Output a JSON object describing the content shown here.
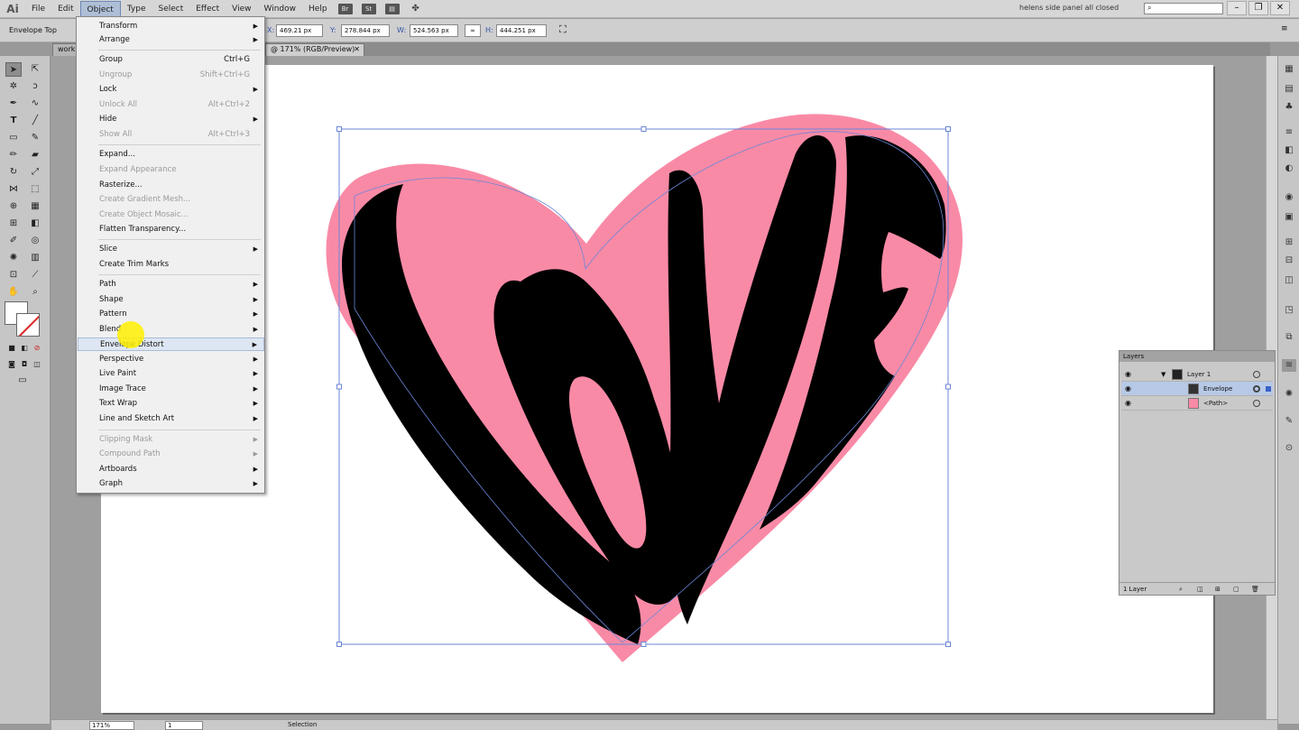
{
  "app": {
    "logo": "Ai"
  },
  "menubar": {
    "items": [
      "File",
      "Edit",
      "Object",
      "Type",
      "Select",
      "Effect",
      "View",
      "Window",
      "Help"
    ],
    "active": "Object",
    "icons": [
      "Br",
      "St"
    ],
    "workspace": "helens side panel all closed",
    "search_placeholder": ""
  },
  "control_bar": {
    "selection_label": "Envelope Top",
    "x_label": "X:",
    "x_value": "469.21 px",
    "y_label": "Y:",
    "y_value": "278.844 px",
    "w_label": "W:",
    "w_value": "524.563 px",
    "h_label": "H:",
    "h_value": "444.251 px"
  },
  "tabs": [
    {
      "label": "workl"
    },
    {
      "label": "@ 171% (RGB/Preview)"
    }
  ],
  "object_menu": {
    "items": [
      {
        "label": "Transform",
        "submenu": true
      },
      {
        "label": "Arrange",
        "submenu": true
      },
      {
        "label": "Group",
        "shortcut": "Ctrl+G"
      },
      {
        "label": "Ungroup",
        "shortcut": "Shift+Ctrl+G",
        "disabled": true
      },
      {
        "label": "Lock",
        "submenu": true
      },
      {
        "label": "Unlock All",
        "shortcut": "Alt+Ctrl+2",
        "disabled": true
      },
      {
        "label": "Hide",
        "submenu": true
      },
      {
        "label": "Show All",
        "shortcut": "Alt+Ctrl+3",
        "disabled": true
      },
      {
        "label": "Expand..."
      },
      {
        "label": "Expand Appearance",
        "disabled": true
      },
      {
        "label": "Rasterize..."
      },
      {
        "label": "Create Gradient Mesh...",
        "disabled": true
      },
      {
        "label": "Create Object Mosaic...",
        "disabled": true
      },
      {
        "label": "Flatten Transparency..."
      },
      {
        "label": "Slice",
        "submenu": true
      },
      {
        "label": "Create Trim Marks"
      },
      {
        "label": "Path",
        "submenu": true
      },
      {
        "label": "Shape",
        "submenu": true
      },
      {
        "label": "Pattern",
        "submenu": true
      },
      {
        "label": "Blend",
        "submenu": true
      },
      {
        "label": "Envelope Distort",
        "submenu": true,
        "highlighted": true
      },
      {
        "label": "Perspective",
        "submenu": true
      },
      {
        "label": "Live Paint",
        "submenu": true
      },
      {
        "label": "Image Trace",
        "submenu": true
      },
      {
        "label": "Text Wrap",
        "submenu": true
      },
      {
        "label": "Line and Sketch Art",
        "submenu": true
      },
      {
        "label": "Clipping Mask",
        "submenu": true,
        "disabled": true
      },
      {
        "label": "Compound Path",
        "submenu": true,
        "disabled": true
      },
      {
        "label": "Artboards",
        "submenu": true
      },
      {
        "label": "Graph",
        "submenu": true
      }
    ]
  },
  "layers_panel": {
    "title": "Layers",
    "rows": [
      {
        "name": "Layer 1"
      },
      {
        "name": "Envelope",
        "selected": true
      },
      {
        "name": "<Path>"
      }
    ],
    "footer": "1 Layer"
  },
  "status_bar": {
    "zoom": "171%",
    "artboard": "1",
    "tool": "Selection"
  },
  "colors": {
    "heart_fill": "#f98aa6",
    "letter_fill": "#000000",
    "selection": "#6b86d6",
    "menu_highlight": "#dde6f2"
  }
}
